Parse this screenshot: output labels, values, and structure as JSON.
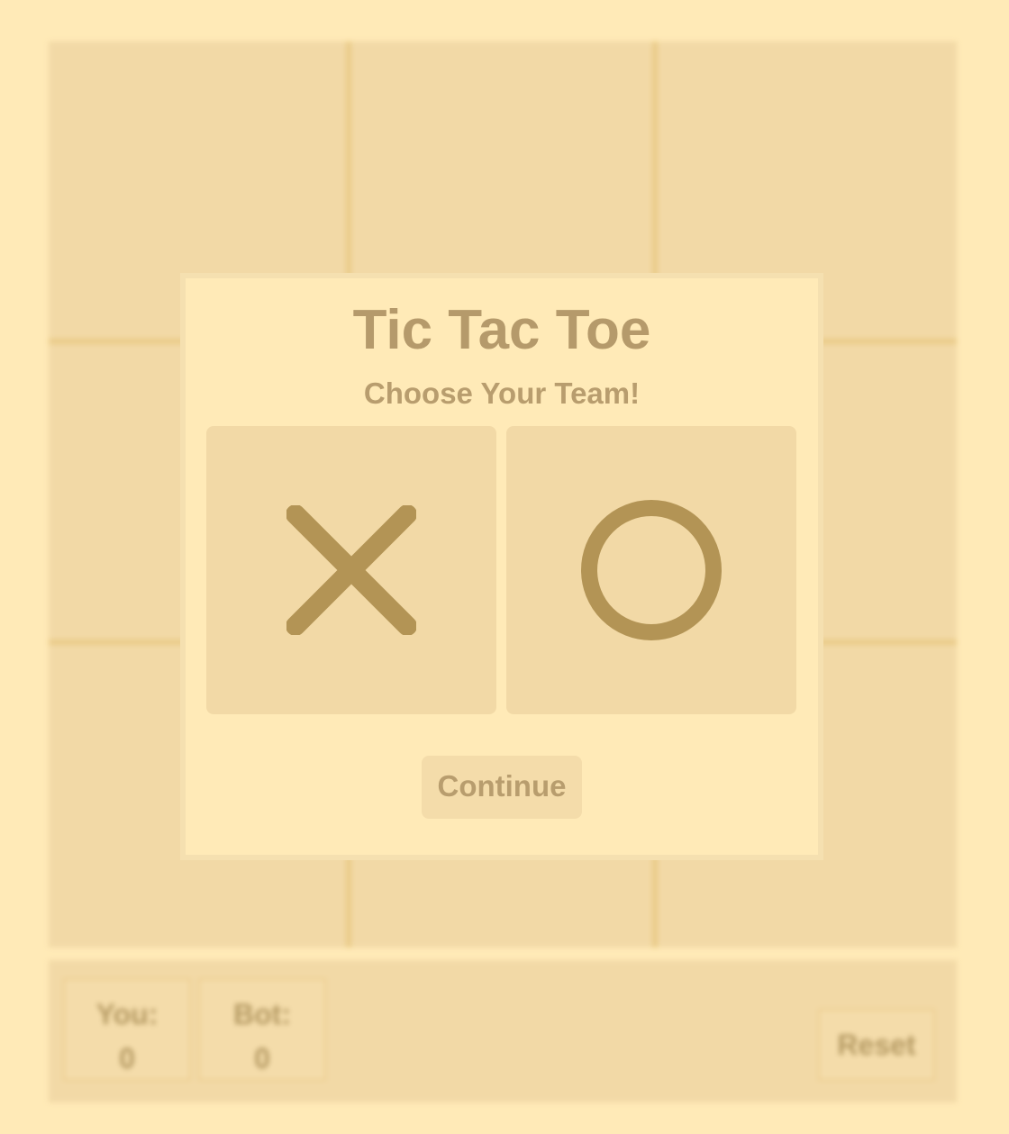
{
  "modal": {
    "title": "Tic Tac Toe",
    "subtitle": "Choose Your Team!",
    "options": [
      {
        "symbol": "X",
        "icon": "x-mark-icon"
      },
      {
        "symbol": "O",
        "icon": "o-mark-icon"
      }
    ],
    "continue_label": "Continue"
  },
  "scoreboard": {
    "you_label": "You:",
    "you_score": "0",
    "bot_label": "Bot:",
    "bot_score": "0",
    "reset_label": "Reset"
  },
  "colors": {
    "background": "#FFEAB7",
    "board": "#F2D9A6",
    "grid_line": "#EACB88",
    "mark": "#B39455",
    "text": "#B59A6B"
  }
}
